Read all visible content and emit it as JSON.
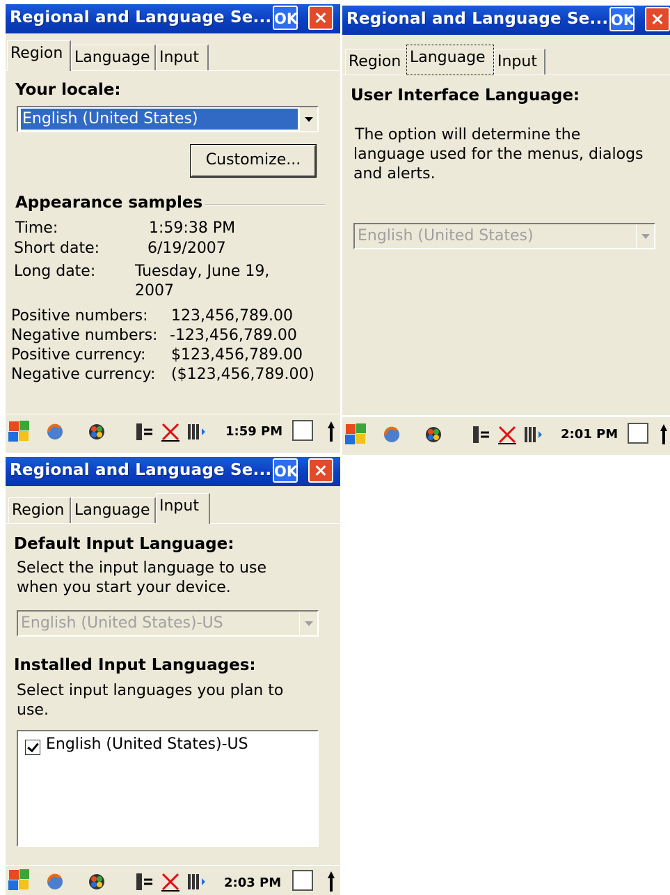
{
  "window_title": "Regional and Language Se...",
  "ok_label": "OK",
  "tabs": [
    "Region",
    "Language",
    "Input"
  ],
  "region": {
    "locale_label": "Your locale:",
    "locale_value": "English (United States)",
    "customize_label": "Customize...",
    "appearance_label": "Appearance samples",
    "time_label": "Time:",
    "time_value": "1:59:38 PM",
    "short_date_label": "Short date:",
    "short_date_value": "6/19/2007",
    "long_date_label": "Long date:",
    "long_date_value_1": "Tuesday, June 19,",
    "long_date_value_2": "2007",
    "pos_num_label": "Positive numbers:",
    "pos_num_value": "123,456,789.00",
    "neg_num_label": "Negative numbers:",
    "neg_num_value": "-123,456,789.00",
    "pos_cur_label": "Positive currency:",
    "pos_cur_value": "$123,456,789.00",
    "neg_cur_label": "Negative currency:",
    "neg_cur_value": "($123,456,789.00)",
    "clock": "1:59 PM"
  },
  "language": {
    "heading": "User Interface Language:",
    "desc_1": "The option will determine the",
    "desc_2": "language used for the menus, dialogs",
    "desc_3": "and alerts.",
    "combo_value": "English (United States)",
    "clock": "2:01 PM"
  },
  "input": {
    "default_heading": "Default Input Language:",
    "default_desc_1": "Select the input language to use",
    "default_desc_2": "when you start your device.",
    "default_value": "English (United States)-US",
    "installed_heading": "Installed Input Languages:",
    "installed_desc_1": "Select input languages you plan to",
    "installed_desc_2": "use.",
    "installed_items": [
      {
        "label": "English (United States)-US",
        "checked": true
      }
    ],
    "clock": "2:03 PM"
  },
  "colors": {
    "titlebar": "#0a3fc2",
    "panel": "#ece9d8",
    "selection": "#316ac5",
    "close": "#e24a2a"
  }
}
